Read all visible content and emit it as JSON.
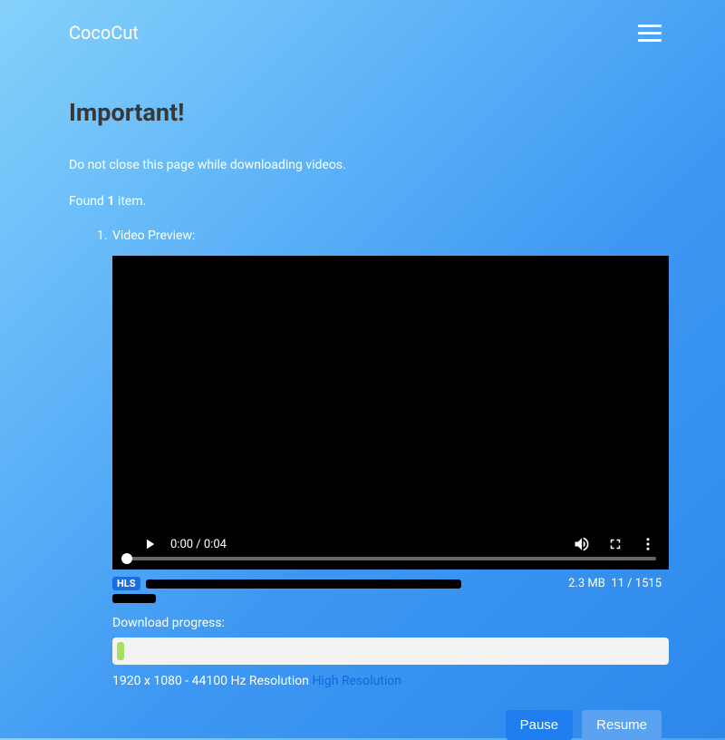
{
  "header": {
    "brand": "CocoCut"
  },
  "important_heading": "Important!",
  "warning_text": "Do not close this page while downloading videos.",
  "found": {
    "prefix": "Found ",
    "count": "1",
    "suffix": " item."
  },
  "video": {
    "preview_label": "Video Preview:",
    "time": "0:00 / 0:04"
  },
  "meta": {
    "stream_type": "HLS",
    "size": "2.3 MB",
    "frames": "11 / 1515"
  },
  "download": {
    "progress_label": "Download progress:",
    "resolution_info": "1920 x 1080 - 44100 Hz  Resolution ",
    "resolution_link": "High Resolution"
  },
  "buttons": {
    "pause": "Pause",
    "resume": "Resume"
  }
}
